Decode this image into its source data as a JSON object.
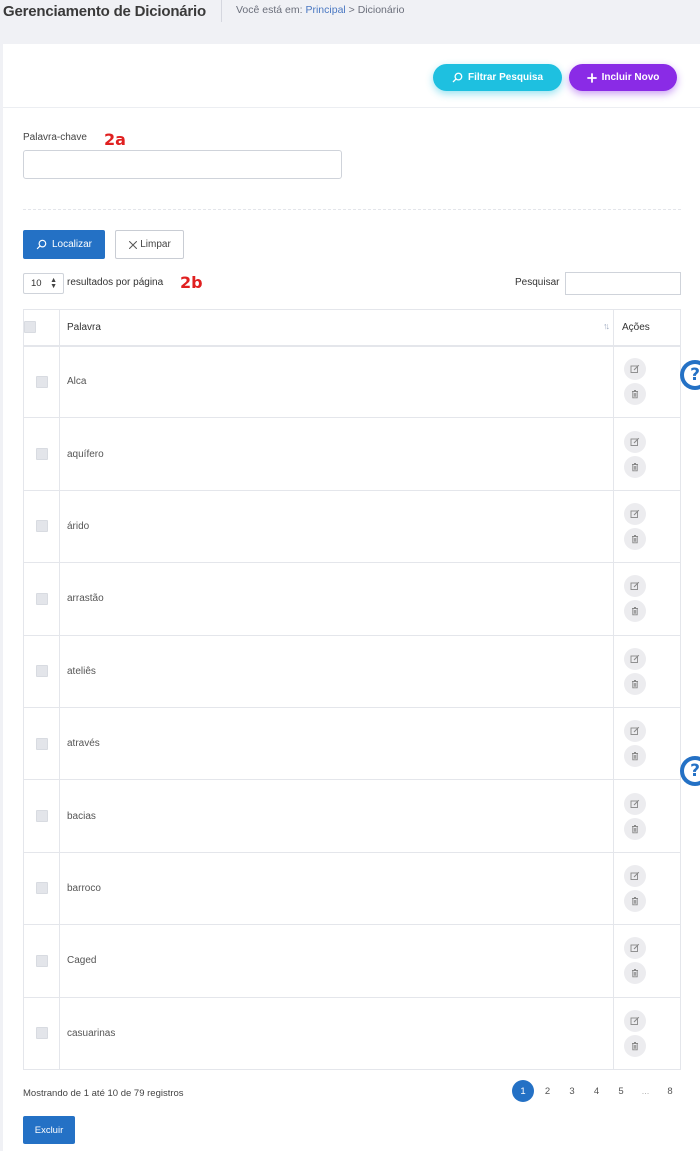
{
  "header": {
    "title": "Gerenciamento de Dicionário",
    "breadcrumb_prefix": "Você está em: ",
    "breadcrumb_link": "Principal",
    "breadcrumb_sep": " > ",
    "breadcrumb_current": "Dicionário"
  },
  "toolbar": {
    "filter_label": "Filtrar Pesquisa",
    "new_label": "Incluir Novo",
    "filter_color": "#1ec0e0",
    "new_color": "#8a2be6"
  },
  "filter": {
    "keyword_label": "Palavra-chave",
    "keyword_value": "",
    "search_label": "Localizar",
    "clear_label": "Limpar"
  },
  "annotations": {
    "a": "2a",
    "b": "2b"
  },
  "table_controls": {
    "page_size": "10",
    "page_size_suffix": "resultados por página",
    "search_label": "Pesquisar",
    "search_value": ""
  },
  "table": {
    "columns": [
      "",
      "Palavra",
      "Ações"
    ],
    "rows": [
      {
        "word": "Alca"
      },
      {
        "word": "aquífero"
      },
      {
        "word": "árido"
      },
      {
        "word": "arrastão"
      },
      {
        "word": "ateliês"
      },
      {
        "word": "através"
      },
      {
        "word": "bacias"
      },
      {
        "word": "barroco"
      },
      {
        "word": "Caged"
      },
      {
        "word": "casuarinas"
      }
    ]
  },
  "footer": {
    "info": "Mostrando de 1 até 10 de 79 registros",
    "pages": [
      "1",
      "2",
      "3",
      "4",
      "5",
      "…",
      "8"
    ],
    "active_page": "1",
    "delete_label": "Excluir"
  },
  "help": {
    "symbol": "?"
  },
  "colors": {
    "primary": "#2471c5"
  }
}
